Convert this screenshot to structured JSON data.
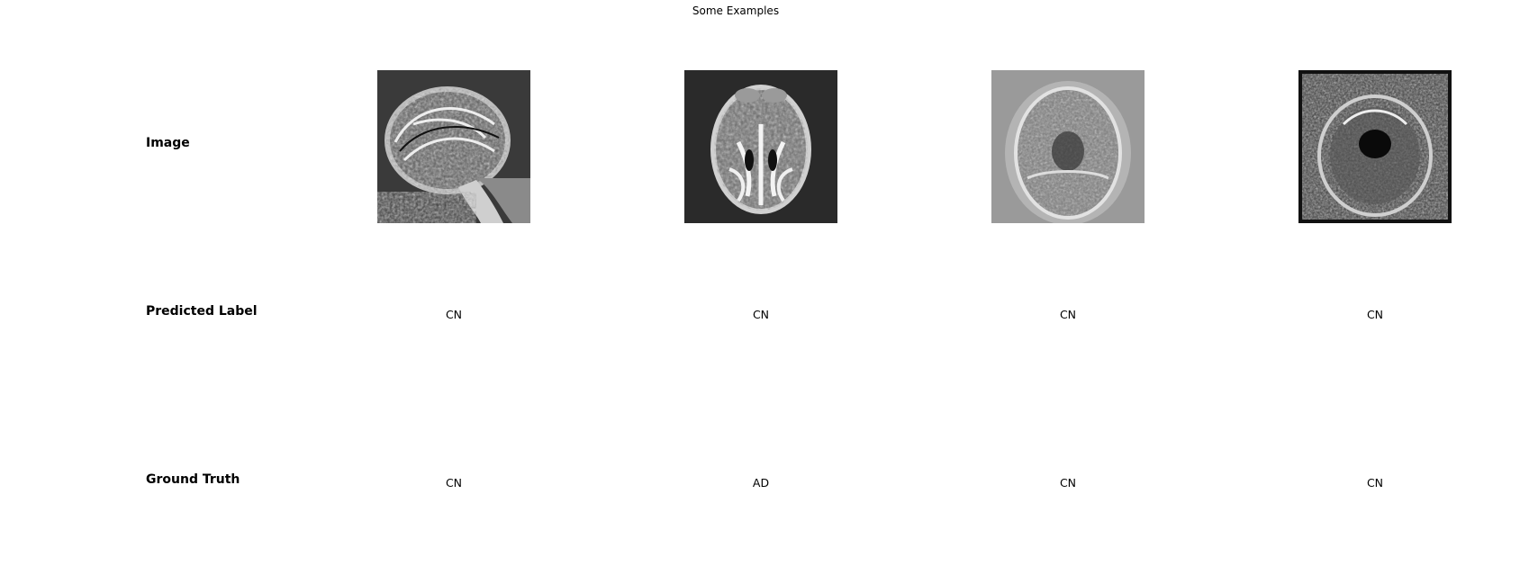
{
  "figure": {
    "title": "Some Examples"
  },
  "rows": {
    "image_label": "Image",
    "predicted_label": "Predicted Label",
    "ground_truth_label": "Ground Truth"
  },
  "examples": [
    {
      "view": "sagittal brain MRI slice",
      "predicted": "CN",
      "ground_truth": "CN",
      "background": "#3a3a3a"
    },
    {
      "view": "axial brain MRI slice",
      "predicted": "CN",
      "ground_truth": "AD",
      "background": "#2a2a2a"
    },
    {
      "view": "axial brain MRI slice",
      "predicted": "CN",
      "ground_truth": "CN",
      "background": "#9a9a9a"
    },
    {
      "view": "axial brain MRI slice",
      "predicted": "CN",
      "ground_truth": "CN",
      "background": "#2e2e2e"
    }
  ]
}
